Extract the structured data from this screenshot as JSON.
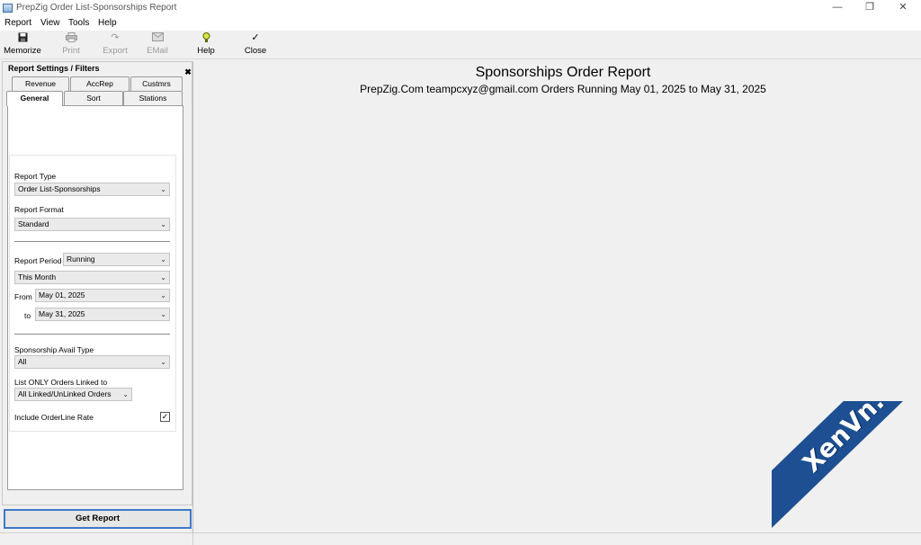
{
  "window": {
    "title": "PrepZig Order List-Sponsorships Report"
  },
  "menu": {
    "items": [
      "Report",
      "View",
      "Tools",
      "Help"
    ]
  },
  "toolbar": {
    "memorize": "Memorize",
    "print": "Print",
    "export": "Export",
    "email": "EMail",
    "help": "Help",
    "close": "Close"
  },
  "panel": {
    "title": "Report Settings / Filters",
    "tabs_row1": [
      "Revenue",
      "AccRep",
      "Custmrs"
    ],
    "tabs_row2": [
      "General",
      "Sort",
      "Stations"
    ],
    "active_tab": "General",
    "report_type_label": "Report Type",
    "report_type_value": "Order List-Sponsorships",
    "report_format_label": "Report Format",
    "report_format_value": "Standard",
    "report_period_label": "Report Period",
    "report_period_value": "Running",
    "period_range_value": "This Month",
    "from_label": "From",
    "from_value": "May 01, 2025",
    "to_label": "to",
    "to_value": "May 31, 2025",
    "avail_type_label": "Sponsorship Avail Type",
    "avail_type_value": "All",
    "linked_label": "List ONLY Orders Linked to",
    "linked_value": "All Linked/UnLinked Orders",
    "include_rate_label": "Include OrderLine Rate",
    "include_rate_checked": true,
    "get_report": "Get Report"
  },
  "report": {
    "title": "Sponsorships Order Report",
    "subtitle": "PrepZig.Com  teampcxyz@gmail.com  Orders Running May 01, 2025 to May 31, 2025"
  },
  "watermark": {
    "text": "XenVn.Com"
  },
  "colors": {
    "accent": "#3f78c8",
    "watermark": "#1d4f92"
  }
}
